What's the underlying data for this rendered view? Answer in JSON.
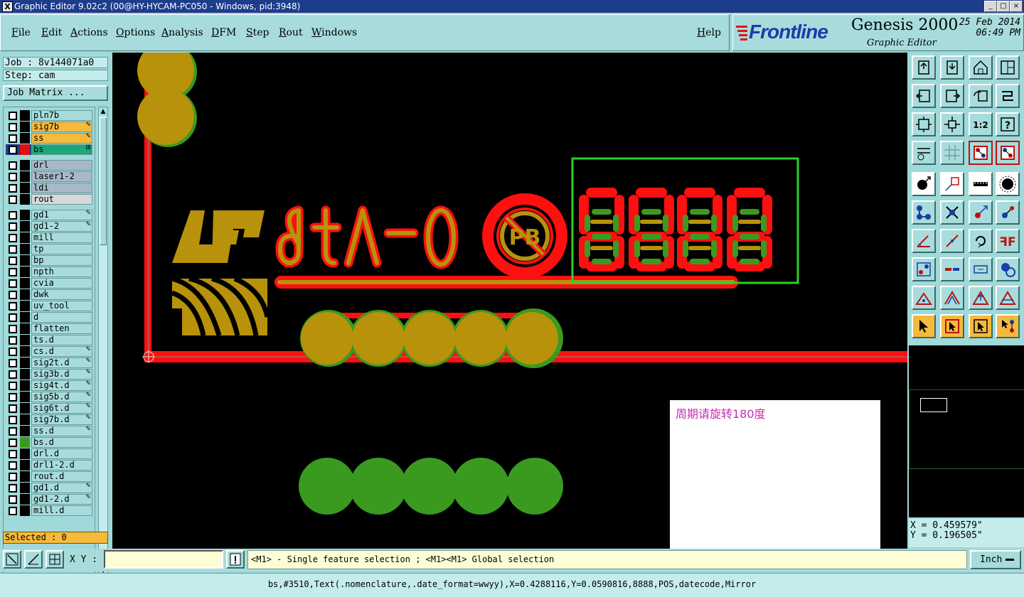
{
  "window": {
    "title": "Graphic Editor 9.02c2 (00@HY-HYCAM-PC050 - Windows, pid:3948)"
  },
  "menu": [
    "File",
    "Edit",
    "Actions",
    "Options",
    "Analysis",
    "DFM",
    "Step",
    "Rout",
    "Windows"
  ],
  "help_label": "Help",
  "brand": {
    "logo": "Frontline",
    "product": "Genesis 2000",
    "subtitle": "Graphic Editor",
    "date": "25 Feb 2014",
    "time": "06:49 PM"
  },
  "job_label": "Job : 8v144071a0",
  "step_label": "Step: cam",
  "job_matrix_label": "Job Matrix ...",
  "layers": [
    {
      "name": "pln7b",
      "color": "#000000",
      "bg": "#a8dcdc",
      "marker": ""
    },
    {
      "name": "sig7b",
      "color": "#000000",
      "bg": "#f5b93c",
      "marker": "✎"
    },
    {
      "name": "ss",
      "color": "#000000",
      "bg": "#f5b93c",
      "marker": "✎"
    },
    {
      "name": "bs",
      "color": "#e01010",
      "bg": "#1aa87a",
      "marker": "⊞",
      "active": true
    },
    {
      "name": "drl",
      "color": "#000000",
      "bg": "#a8b8c8",
      "marker": ""
    },
    {
      "name": "laser1-2",
      "color": "#000000",
      "bg": "#a8b8c8",
      "marker": ""
    },
    {
      "name": "ldi",
      "color": "#000000",
      "bg": "#a8b8c8",
      "marker": ""
    },
    {
      "name": "rout",
      "color": "#000000",
      "bg": "#d8d8d8",
      "marker": ""
    },
    {
      "name": "gd1",
      "color": "#000000",
      "bg": "#a8dcdc",
      "marker": "✎"
    },
    {
      "name": "gd1-2",
      "color": "#000000",
      "bg": "#a8dcdc",
      "marker": "✎"
    },
    {
      "name": "mill",
      "color": "#000000",
      "bg": "#a8dcdc",
      "marker": ""
    },
    {
      "name": "tp",
      "color": "#000000",
      "bg": "#a8dcdc",
      "marker": ""
    },
    {
      "name": "bp",
      "color": "#000000",
      "bg": "#a8dcdc",
      "marker": ""
    },
    {
      "name": "npth",
      "color": "#000000",
      "bg": "#a8dcdc",
      "marker": ""
    },
    {
      "name": "cvia",
      "color": "#000000",
      "bg": "#a8dcdc",
      "marker": ""
    },
    {
      "name": "dwk",
      "color": "#000000",
      "bg": "#a8dcdc",
      "marker": ""
    },
    {
      "name": "uv_tool",
      "color": "#000000",
      "bg": "#a8dcdc",
      "marker": ""
    },
    {
      "name": "d",
      "color": "#000000",
      "bg": "#a8dcdc",
      "marker": ""
    },
    {
      "name": "flatten",
      "color": "#000000",
      "bg": "#a8dcdc",
      "marker": ""
    },
    {
      "name": "ts.d",
      "color": "#000000",
      "bg": "#a8dcdc",
      "marker": ""
    },
    {
      "name": "cs.d",
      "color": "#000000",
      "bg": "#a8dcdc",
      "marker": "✎"
    },
    {
      "name": "sig2t.d",
      "color": "#000000",
      "bg": "#a8dcdc",
      "marker": "✎"
    },
    {
      "name": "sig3b.d",
      "color": "#000000",
      "bg": "#a8dcdc",
      "marker": "✎"
    },
    {
      "name": "sig4t.d",
      "color": "#000000",
      "bg": "#a8dcdc",
      "marker": "✎"
    },
    {
      "name": "sig5b.d",
      "color": "#000000",
      "bg": "#a8dcdc",
      "marker": "✎"
    },
    {
      "name": "sig6t.d",
      "color": "#000000",
      "bg": "#a8dcdc",
      "marker": "✎"
    },
    {
      "name": "sig7b.d",
      "color": "#000000",
      "bg": "#a8dcdc",
      "marker": "✎"
    },
    {
      "name": "ss.d",
      "color": "#000000",
      "bg": "#a8dcdc",
      "marker": "✎"
    },
    {
      "name": "bs.d",
      "color": "#3a9a20",
      "bg": "#a8dcdc",
      "marker": ""
    },
    {
      "name": "drl.d",
      "color": "#000000",
      "bg": "#a8dcdc",
      "marker": ""
    },
    {
      "name": "drl1-2.d",
      "color": "#000000",
      "bg": "#a8dcdc",
      "marker": ""
    },
    {
      "name": "rout.d",
      "color": "#000000",
      "bg": "#a8dcdc",
      "marker": ""
    },
    {
      "name": "gd1.d",
      "color": "#000000",
      "bg": "#a8dcdc",
      "marker": "✎"
    },
    {
      "name": "gd1-2.d",
      "color": "#000000",
      "bg": "#a8dcdc",
      "marker": "✎"
    },
    {
      "name": "mill.d",
      "color": "#000000",
      "bg": "#a8dcdc",
      "marker": ""
    }
  ],
  "selected_label": "Selected : 0",
  "canvas": {
    "mirror_text": "9tv-0",
    "digits": "8888",
    "note": "周期请旋转180度"
  },
  "coords": {
    "x": "X = 0.459579\"",
    "y": "Y = 0.196505\""
  },
  "xy_label": "X Y :",
  "xy_value": "",
  "message": "<M1> - Single feature selection ; <M1><M1> Global selection",
  "unit": "Inch",
  "status": "bs,#3510,Text(.nomenclature,.date_format=wwyy),X=0.4288116,Y=0.0590816,8888,POS,datecode,Mirror"
}
